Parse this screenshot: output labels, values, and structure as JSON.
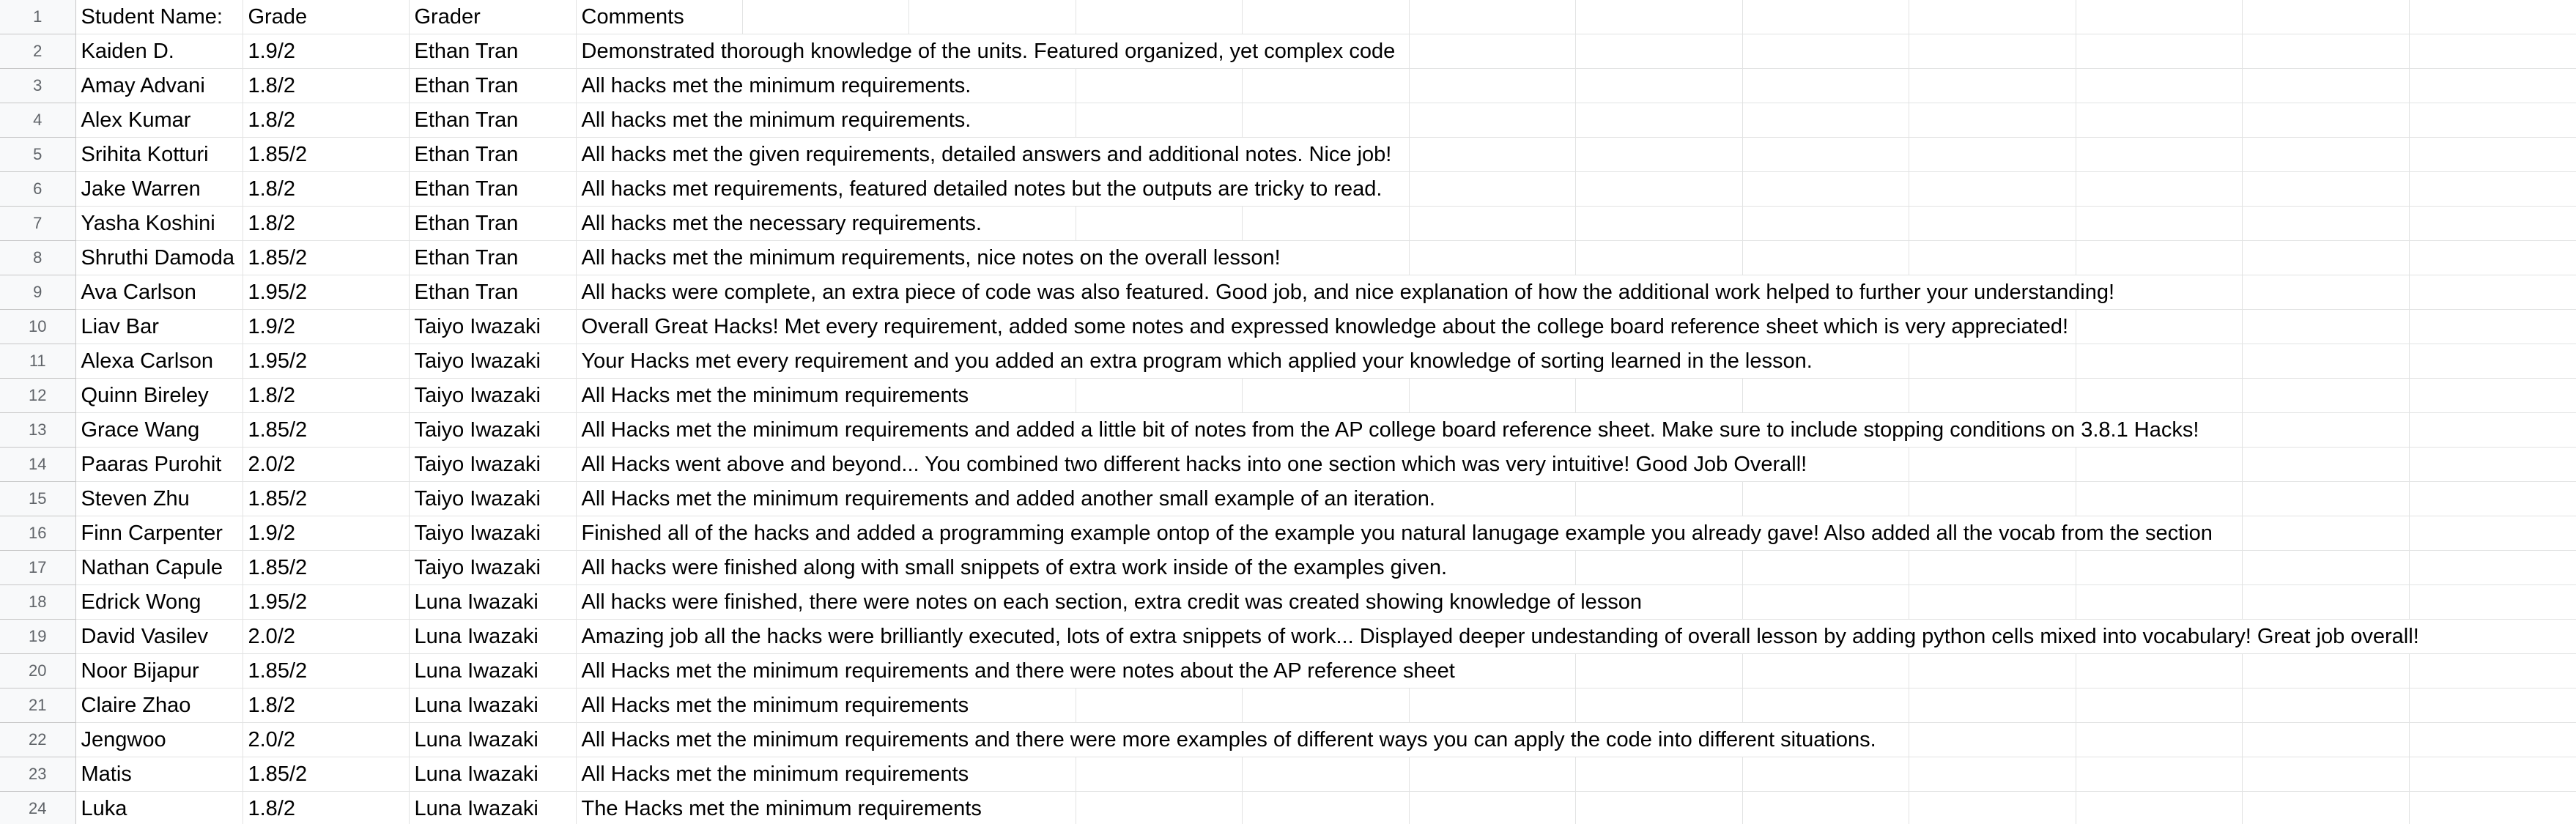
{
  "sheet": {
    "header": {
      "row_number": "1",
      "student_name": "Student Name:",
      "grade": "Grade",
      "grader": "Grader",
      "comments": "Comments"
    },
    "rows": [
      {
        "n": "2",
        "student": "Kaiden D.",
        "grade": "1.9/2",
        "grader": "Ethan Tran",
        "comment": "Demonstrated thorough knowledge of the units. Featured organized, yet complex code"
      },
      {
        "n": "3",
        "student": "Amay Advani",
        "grade": "1.8/2",
        "grader": "Ethan Tran",
        "comment": "All hacks met the minimum requirements."
      },
      {
        "n": "4",
        "student": "Alex Kumar",
        "grade": "1.8/2",
        "grader": "Ethan Tran",
        "comment": "All hacks met the minimum requirements."
      },
      {
        "n": "5",
        "student": "Srihita Kotturi",
        "grade": "1.85/2",
        "grader": "Ethan Tran",
        "comment": "All hacks met the given requirements, detailed answers and additional notes. Nice job!"
      },
      {
        "n": "6",
        "student": "Jake Warren",
        "grade": "1.8/2",
        "grader": "Ethan Tran",
        "comment": "All hacks met requirements, featured detailed notes but the outputs are tricky to read."
      },
      {
        "n": "7",
        "student": "Yasha Koshini",
        "grade": "1.8/2",
        "grader": "Ethan Tran",
        "comment": "All hacks met the necessary requirements."
      },
      {
        "n": "8",
        "student": "Shruthi Damoda",
        "grade": "1.85/2",
        "grader": "Ethan Tran",
        "comment": "All hacks met the minimum requirements, nice notes on the overall lesson!"
      },
      {
        "n": "9",
        "student": "Ava Carlson",
        "grade": "1.95/2",
        "grader": "Ethan Tran",
        "comment": "All hacks were complete, an extra piece of code was also featured. Good job, and nice explanation of how the additional work helped to further your understanding!"
      },
      {
        "n": "10",
        "student": "Liav Bar",
        "grade": "1.9/2",
        "grader": "Taiyo Iwazaki",
        "comment": "Overall Great Hacks! Met every requirement, added some notes and expressed knowledge about the college board reference sheet which is very appreciated!"
      },
      {
        "n": "11",
        "student": "Alexa Carlson",
        "grade": "1.95/2",
        "grader": "Taiyo Iwazaki",
        "comment": "Your Hacks met every requirement and you added an extra program which applied your knowledge of sorting learned in the lesson."
      },
      {
        "n": "12",
        "student": "Quinn Bireley",
        "grade": "1.8/2",
        "grader": "Taiyo Iwazaki",
        "comment": "All Hacks met the minimum requirements"
      },
      {
        "n": "13",
        "student": "Grace Wang",
        "grade": "1.85/2",
        "grader": "Taiyo Iwazaki",
        "comment": "All Hacks met the minimum requirements and added a little bit of notes from the AP college board reference sheet. Make sure to include stopping conditions on 3.8.1 Hacks!"
      },
      {
        "n": "14",
        "student": "Paaras Purohit",
        "grade": "2.0/2",
        "grader": "Taiyo Iwazaki",
        "comment": "All Hacks went above and beyond... You combined two different hacks into one section which was very intuitive! Good Job Overall!"
      },
      {
        "n": "15",
        "student": "Steven Zhu",
        "grade": "1.85/2",
        "grader": "Taiyo Iwazaki",
        "comment": "All Hacks met the minimum requirements and added another small example of an iteration."
      },
      {
        "n": "16",
        "student": "Finn Carpenter",
        "grade": "1.9/2",
        "grader": "Taiyo Iwazaki",
        "comment": "Finished all of the hacks and added a programming example ontop of the example you natural lanugage example you already gave! Also added all the vocab from the section"
      },
      {
        "n": "17",
        "student": "Nathan Capule",
        "grade": "1.85/2",
        "grader": "Taiyo Iwazaki",
        "comment": "All hacks were finished along with small snippets of extra work inside of the examples given."
      },
      {
        "n": "18",
        "student": "Edrick Wong",
        "grade": "1.95/2",
        "grader": "Luna Iwazaki",
        "comment": "All hacks were finished, there were notes on each section, extra credit was created showing knowledge of lesson"
      },
      {
        "n": "19",
        "student": "David Vasilev",
        "grade": "2.0/2",
        "grader": "Luna Iwazaki",
        "comment": "Amazing job all the hacks were brilliantly executed, lots of extra snippets of work... Displayed deeper undestanding of overall lesson by adding python cells mixed into vocabulary! Great job overall!"
      },
      {
        "n": "20",
        "student": "Noor Bijapur",
        "grade": "1.85/2",
        "grader": "Luna Iwazaki",
        "comment": "All Hacks met the minimum requirements and there were notes about the AP reference sheet"
      },
      {
        "n": "21",
        "student": "Claire Zhao",
        "grade": "1.8/2",
        "grader": "Luna Iwazaki",
        "comment": "All Hacks met the minimum requirements"
      },
      {
        "n": "22",
        "student": "Jengwoo",
        "grade": "2.0/2",
        "grader": "Luna Iwazaki",
        "comment": "All Hacks met the minimum requirements and there were more examples of different ways you can apply the code into different situations."
      },
      {
        "n": "23",
        "student": "Matis",
        "grade": "1.85/2",
        "grader": "Luna Iwazaki",
        "comment": "All Hacks met the minimum requirements"
      },
      {
        "n": "24",
        "student": "Luka",
        "grade": "1.8/2",
        "grader": "Luna Iwazaki",
        "comment": "The Hacks met the minimum requirements"
      }
    ]
  }
}
